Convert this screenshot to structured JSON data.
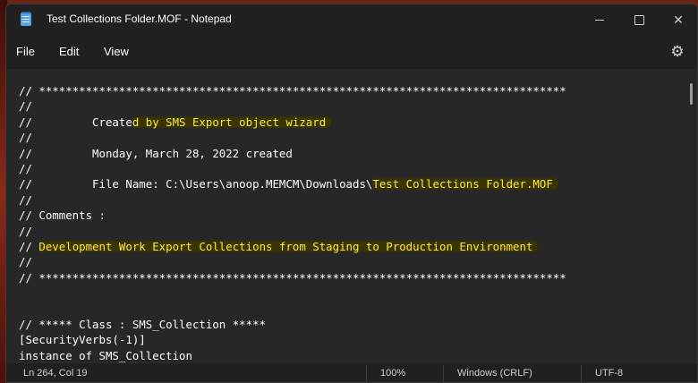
{
  "window": {
    "title": "Test Collections Folder.MOF - Notepad"
  },
  "title_buttons": {
    "minimize": "minimize-icon",
    "maximize": "maximize-icon",
    "close": "✕"
  },
  "menu": {
    "file": "File",
    "edit": "Edit",
    "view": "View",
    "settings_icon": "gear-icon"
  },
  "editor": {
    "lines": [
      "// *******************************************************************************",
      "//",
      "//         Create",
      "//",
      "//         Monday, March 28, 2022 created",
      "//",
      "//         File Name: C:\\Users\\anoop.MEMCM\\Downloads\\",
      "//",
      "// Comments :",
      "//",
      "// ",
      "//",
      "// *******************************************************************************",
      "",
      "",
      "// ***** Class : SMS_Collection *****",
      "[SecurityVerbs(-1)]",
      "instance of SMS_Collection"
    ],
    "highlights": {
      "line3": "d by SMS Export object wizard",
      "line7": "Test Collections Folder.MOF",
      "line11": "Development Work Export Collections from Staging to Production Environment"
    },
    "highlight_color": "#ffeb3b"
  },
  "status": {
    "position": "Ln 264, Col 19",
    "zoom": "100%",
    "line_ending": "Windows (CRLF)",
    "encoding": "UTF-8"
  }
}
